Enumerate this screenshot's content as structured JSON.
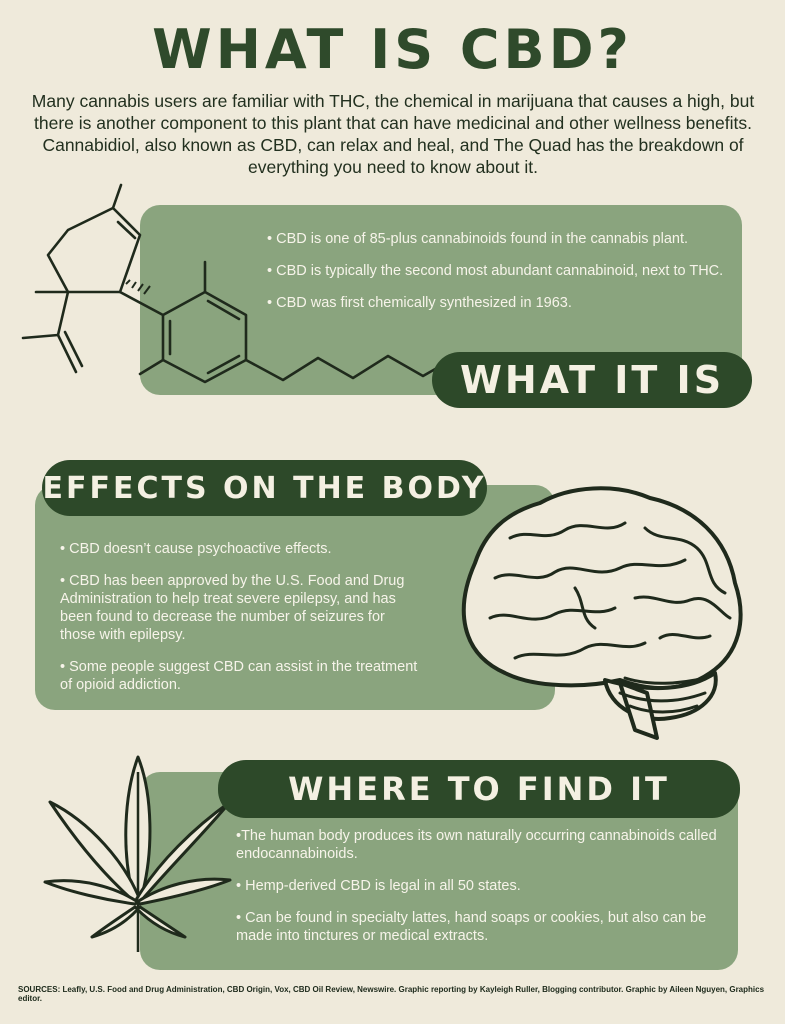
{
  "title": "WHAT IS CBD?",
  "intro": "Many cannabis users are familiar with THC, the chemical in marijuana that causes a high, but there is another component to this plant that can have medicinal and other wellness benefits. Cannabidiol, also known as CBD, can relax and heal, and The Quad has the breakdown of everything you need to know about it.",
  "sections": {
    "what_it_is": {
      "label": "WHAT IT IS",
      "items": [
        "• CBD is one of 85-plus cannabinoids found in the cannabis plant.",
        "• CBD is typically the second most abundant cannabinoid, next to THC.",
        "• CBD was first chemically synthesized in 1963."
      ]
    },
    "effects": {
      "label": "EFFECTS ON THE BODY",
      "items": [
        "• CBD doesn’t cause psychoactive effects.",
        "• CBD has been approved by the U.S. Food and Drug Administration to help treat severe epilepsy, and has been found to decrease the number of seizures for those with epilepsy.",
        "• Some people suggest CBD can assist in the treatment of opioid addiction."
      ]
    },
    "where": {
      "label": "WHERE TO FIND IT",
      "items": [
        "•The human body produces its own naturally occurring cannabinoids called endocannabinoids.",
        "• Hemp-derived CBD is legal in all 50 states.",
        "• Can be found in specialty lattes, hand soaps or cookies, but also can be made into tinctures or medical extracts."
      ]
    }
  },
  "sources": "SOURCES: Leafly, U.S. Food and Drug Administration, CBD Origin, Vox, CBD Oil Review, Newswire. Graphic reporting by Kayleigh Ruller, Blogging contributor. Graphic by Aileen Nguyen, Graphics editor.",
  "colors": {
    "background": "#efeadb",
    "panel": "#8aa47e",
    "label": "#2d4929",
    "ink": "#2f4a2b"
  },
  "icons": [
    "cbd-molecule-icon",
    "brain-icon",
    "cannabis-leaf-icon"
  ]
}
